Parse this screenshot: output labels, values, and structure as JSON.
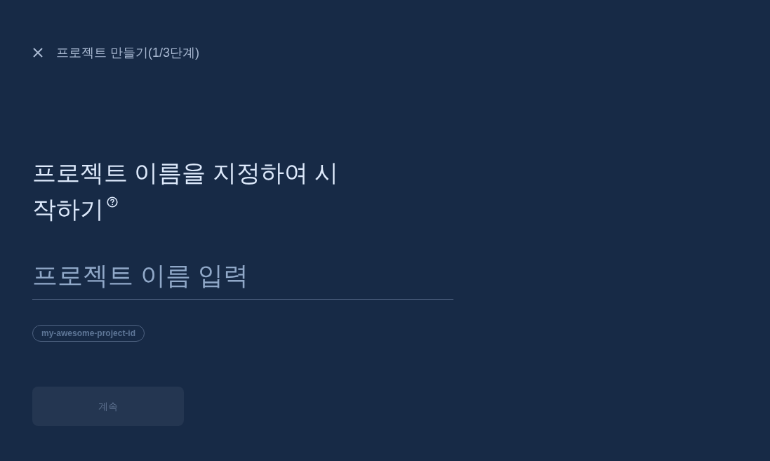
{
  "header": {
    "title": "프로젝트 만들기(1/3단계)"
  },
  "heading": {
    "text": "프로젝트 이름을 지정하여 시작하기"
  },
  "name_field": {
    "placeholder": "프로젝트 이름 입력"
  },
  "project_id_chip": {
    "text": "my-awesome-project-id"
  },
  "continue_button": {
    "label": "계속",
    "disabled": true
  }
}
